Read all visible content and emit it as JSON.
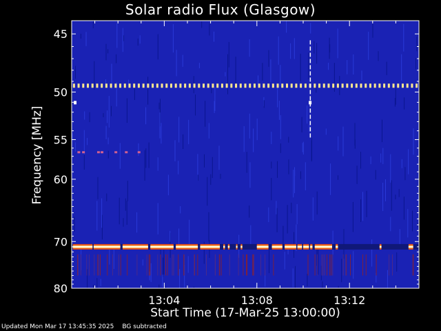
{
  "chart_data": {
    "type": "heatmap",
    "title": "Solar radio Flux (Glasgow)",
    "xlabel": "Start Time (17-Mar-25 13:00:00)",
    "ylabel": "Frequency [MHz]",
    "x_ticks": [
      "13:04",
      "13:08",
      "13:12"
    ],
    "x_tick_minutes": [
      4,
      8,
      12
    ],
    "x_range_minutes": [
      0,
      15
    ],
    "y_ticks": [
      45,
      50,
      55,
      60,
      70,
      80
    ],
    "y_range_mhz": [
      44,
      80
    ],
    "y_scale": "reciprocal",
    "colormap": [
      "#000080",
      "#2030d0",
      "#c03020",
      "#ffa040",
      "#ffffff"
    ],
    "background_color": "#1a22b4",
    "features": [
      {
        "kind": "band",
        "freq_mhz": 49.4,
        "intensity": "bright",
        "pattern": "periodic dots"
      },
      {
        "kind": "band",
        "freq_mhz": 71.0,
        "intensity": "saturated",
        "pattern": "intermittent bursts"
      },
      {
        "kind": "band",
        "freq_mhz": 56.5,
        "intensity": "moderate",
        "pattern": "sparse short bursts"
      },
      {
        "kind": "vertical_spike",
        "time_minutes": 10.3,
        "freq_range_mhz": [
          45.5,
          54.5
        ]
      }
    ]
  },
  "footer": {
    "updated": "Updated Mon Mar 17 13:45:35 2025",
    "note": "BG subtracted"
  }
}
